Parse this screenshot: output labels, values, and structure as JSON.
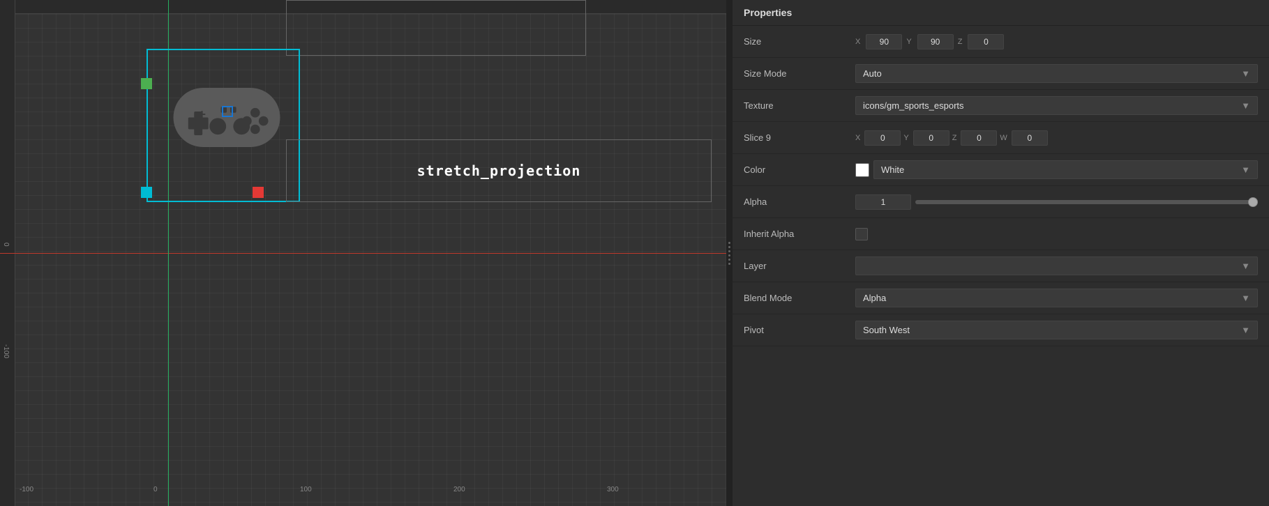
{
  "panel": {
    "title": "Properties"
  },
  "canvas": {
    "stretch_label": "stretch_projection"
  },
  "properties": {
    "size_label": "Size",
    "size_x_label": "X",
    "size_x_value": "90",
    "size_y_label": "Y",
    "size_y_value": "90",
    "size_z_label": "Z",
    "size_z_value": "0",
    "size_mode_label": "Size Mode",
    "size_mode_value": "Auto",
    "texture_label": "Texture",
    "texture_value": "icons/gm_sports_esports",
    "slice9_label": "Slice 9",
    "slice9_x_label": "X",
    "slice9_x_value": "0",
    "slice9_y_label": "Y",
    "slice9_y_value": "0",
    "slice9_z_label": "Z",
    "slice9_z_value": "0",
    "slice9_w_label": "W",
    "slice9_w_value": "0",
    "color_label": "Color",
    "color_value": "White",
    "alpha_label": "Alpha",
    "alpha_value": "1",
    "inherit_alpha_label": "Inherit Alpha",
    "layer_label": "Layer",
    "layer_value": "",
    "blend_mode_label": "Blend Mode",
    "blend_mode_value": "Alpha",
    "pivot_label": "Pivot",
    "pivot_value": "South West"
  },
  "ruler": {
    "labels_bottom": [
      "-100",
      "0",
      "100",
      "200",
      "300"
    ],
    "labels_left": [
      "0",
      "-100"
    ]
  }
}
